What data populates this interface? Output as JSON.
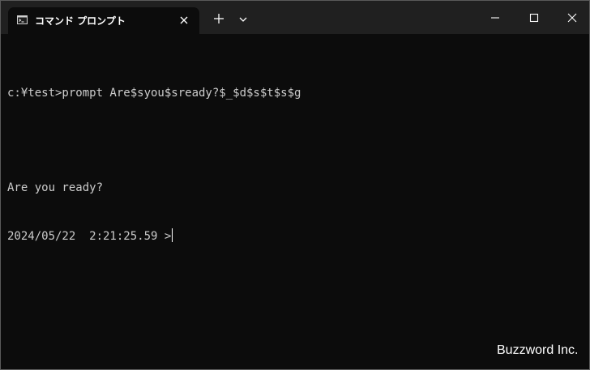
{
  "tab": {
    "title": "コマンド プロンプト",
    "icon": "command-prompt-icon",
    "close_icon": "close-icon"
  },
  "titlebar": {
    "new_tab_icon": "plus-icon",
    "dropdown_icon": "chevron-down-icon",
    "controls": [
      "minimize-icon",
      "maximize-icon",
      "close-icon"
    ]
  },
  "terminal": {
    "lines": [
      "c:¥test>prompt Are$syou$sready?$_$d$s$t$s$g",
      "",
      "Are you ready?",
      "2024/05/22  2:21:25.59 >"
    ],
    "text_color": "#cccccc",
    "background": "#0c0c0c"
  },
  "watermark": "Buzzword Inc."
}
